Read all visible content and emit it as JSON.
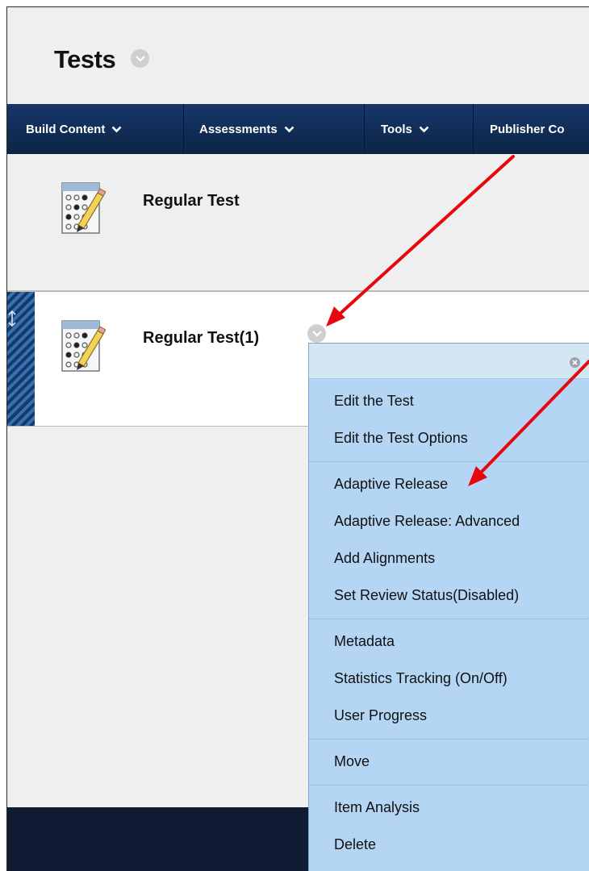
{
  "page": {
    "title": "Tests"
  },
  "toolbar": {
    "items": [
      {
        "label": "Build Content",
        "has_menu": true
      },
      {
        "label": "Assessments",
        "has_menu": true
      },
      {
        "label": "Tools",
        "has_menu": true
      },
      {
        "label": "Publisher Co",
        "has_menu": false
      }
    ]
  },
  "content": {
    "items": [
      {
        "title": "Regular Test",
        "icon": "test-icon"
      },
      {
        "title": "Regular Test(1)",
        "icon": "test-icon"
      }
    ]
  },
  "context_menu": {
    "groups": [
      {
        "items": [
          "Edit the Test",
          "Edit the Test Options"
        ]
      },
      {
        "items": [
          "Adaptive Release",
          "Adaptive Release: Advanced",
          "Add Alignments",
          "Set Review Status(Disabled)"
        ]
      },
      {
        "items": [
          "Metadata",
          "Statistics Tracking (On/Off)",
          "User Progress"
        ]
      },
      {
        "items": [
          "Move"
        ]
      },
      {
        "items": [
          "Item Analysis",
          "Delete"
        ]
      }
    ]
  },
  "colors": {
    "toolbar": "#0d2547",
    "menu_bg": "#b4d5f4",
    "menu_header": "#d3e7f2",
    "annotation_arrow": "#e8070e",
    "footer": "#0f1b33"
  }
}
